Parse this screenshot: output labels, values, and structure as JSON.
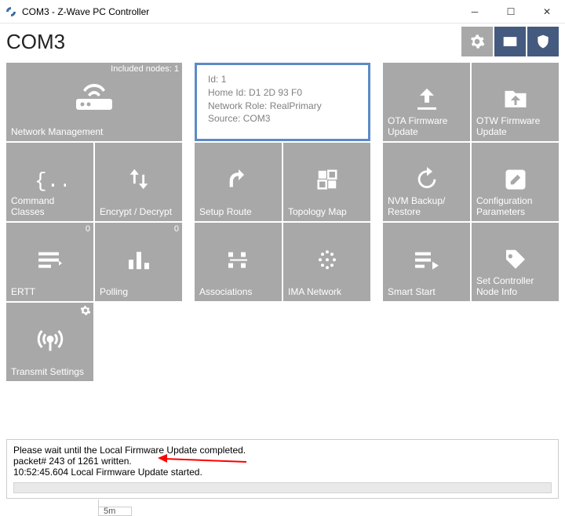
{
  "window": {
    "title": "COM3 - Z-Wave PC Controller"
  },
  "header": {
    "port": "COM3"
  },
  "info": {
    "id_label": "Id:",
    "id_value": "1",
    "home_label": "Home Id:",
    "home_value": "D1 2D 93 F0",
    "role_label": "Network Role:",
    "role_value": "RealPrimary",
    "source_label": "Source:",
    "source_value": "COM3"
  },
  "tiles": {
    "network_mgmt": {
      "label": "Network Management",
      "corner": "Included nodes: 1"
    },
    "ota_fw": {
      "label": "OTA Firmware Update"
    },
    "otw_fw": {
      "label": "OTW Firmware Update"
    },
    "cmd_classes": {
      "label": "Command Classes"
    },
    "encrypt": {
      "label": "Encrypt / Decrypt"
    },
    "setup_route": {
      "label": "Setup Route"
    },
    "topology": {
      "label": "Topology Map"
    },
    "nvm": {
      "label": "NVM Backup/\nRestore"
    },
    "config": {
      "label": "Configuration Parameters"
    },
    "ertt": {
      "label": "ERTT",
      "corner": "0"
    },
    "polling": {
      "label": "Polling",
      "corner": "0"
    },
    "assoc": {
      "label": "Associations"
    },
    "ima": {
      "label": "IMA Network"
    },
    "smart_start": {
      "label": "Smart Start"
    },
    "set_ctrl": {
      "label": "Set Controller Node Info"
    },
    "transmit": {
      "label": "Transmit Settings"
    }
  },
  "status": {
    "line1": "Please wait until the Local Firmware Update completed.",
    "line2": "packet# 243 of 1261 written.",
    "line3": "10:52:45.604 Local Firmware Update started."
  },
  "footer": {
    "zoom": "5m"
  }
}
